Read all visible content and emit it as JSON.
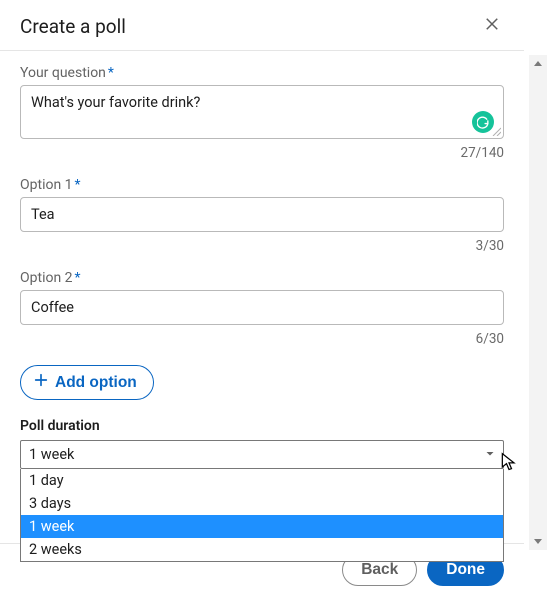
{
  "header": {
    "title": "Create a poll"
  },
  "question": {
    "label": "Your question",
    "required": "*",
    "value": "What's your favorite drink?",
    "counter": "27/140"
  },
  "options": [
    {
      "label": "Option 1",
      "required": "*",
      "value": "Tea",
      "counter": "3/30"
    },
    {
      "label": "Option 2",
      "required": "*",
      "value": "Coffee",
      "counter": "6/30"
    }
  ],
  "add_option_label": "Add option",
  "duration": {
    "label": "Poll duration",
    "selected": "1 week",
    "options": [
      "1 day",
      "3 days",
      "1 week",
      "2 weeks"
    ],
    "highlighted_index": 2
  },
  "footer": {
    "back": "Back",
    "done": "Done"
  },
  "colors": {
    "accent": "#0a66c2",
    "grammarly": "#15c39a",
    "highlight": "#1e90ff"
  }
}
